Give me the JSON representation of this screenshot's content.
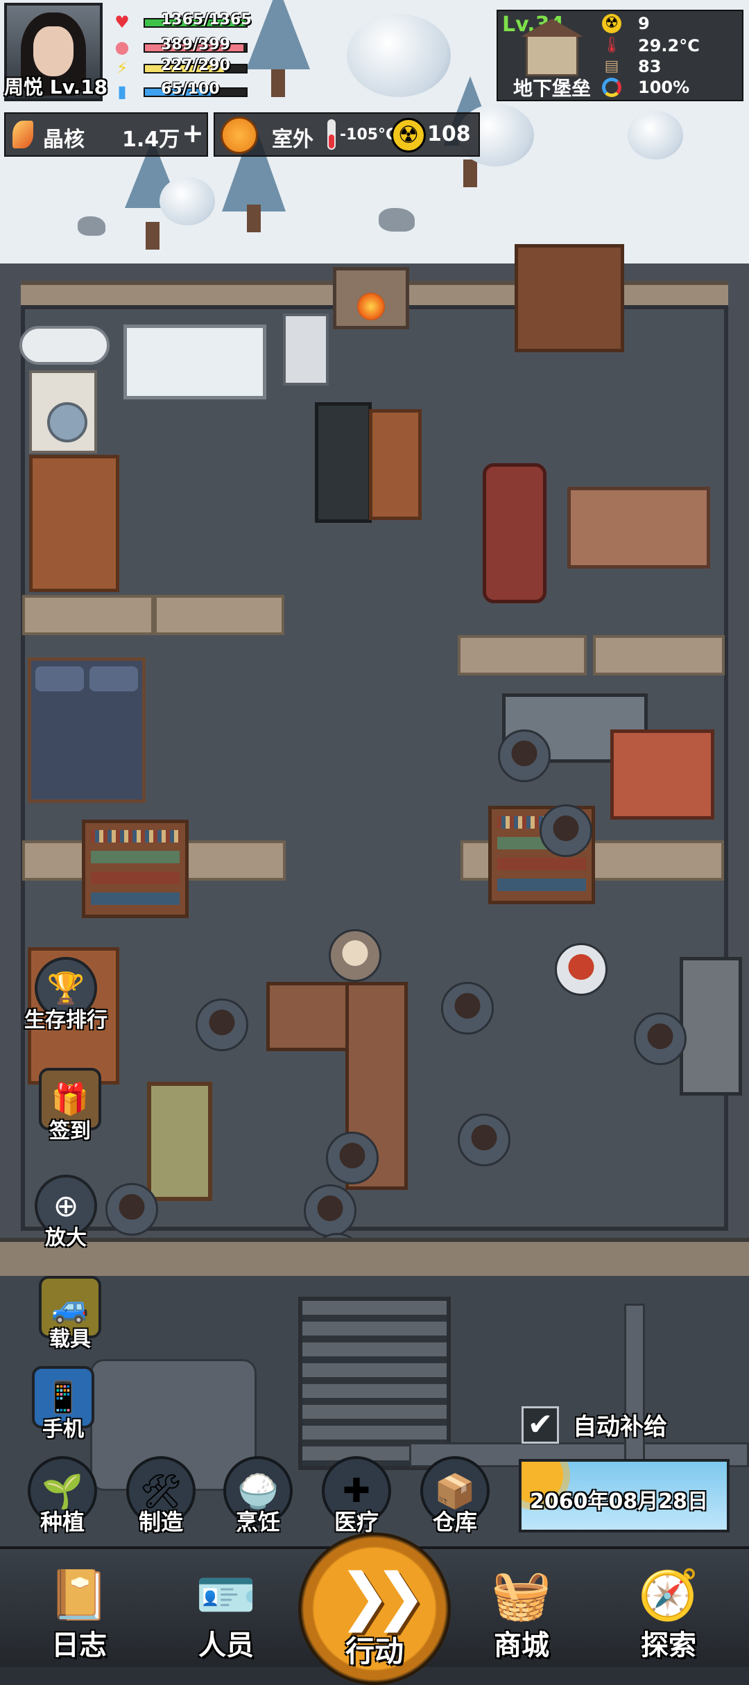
{
  "player": {
    "name_level": "周悦 Lv.18"
  },
  "stats": [
    {
      "icon": "heart-icon",
      "text": "1365/1365",
      "fill": 1.0,
      "color": "#3fc24a"
    },
    {
      "icon": "stomach-icon",
      "text": "389/399",
      "fill": 0.975,
      "color": "#f07b88"
    },
    {
      "icon": "energy-icon",
      "text": "227/290",
      "fill": 0.783,
      "color": "#f5e06a"
    },
    {
      "icon": "water-icon",
      "text": "65/100",
      "fill": 0.65,
      "color": "#3fa2f0"
    }
  ],
  "resource": {
    "label": "晶核",
    "value": "1.4万",
    "add": "+"
  },
  "environment": {
    "location": "室外",
    "temperature": "-105°C",
    "radiation": "108"
  },
  "shelter": {
    "level": "Lv.34",
    "name": "地下堡垒",
    "radiation": "9",
    "temperature": "29.2°C",
    "supplies": "83",
    "integrity": "100%"
  },
  "side_buttons": {
    "ranking": "生存排行",
    "checkin": "签到",
    "zoom": "放大",
    "vehicle": "载具",
    "phone": "手机"
  },
  "functions": {
    "planting": "种植",
    "crafting": "制造",
    "cooking": "烹饪",
    "medical": "医疗",
    "warehouse": "仓库"
  },
  "auto_supply": {
    "label": "自动补给",
    "checked": "✔"
  },
  "date": "2060年08月28日",
  "nav": {
    "log": "日志",
    "staff": "人员",
    "action": "行动",
    "shop": "商城",
    "explore": "探索"
  }
}
